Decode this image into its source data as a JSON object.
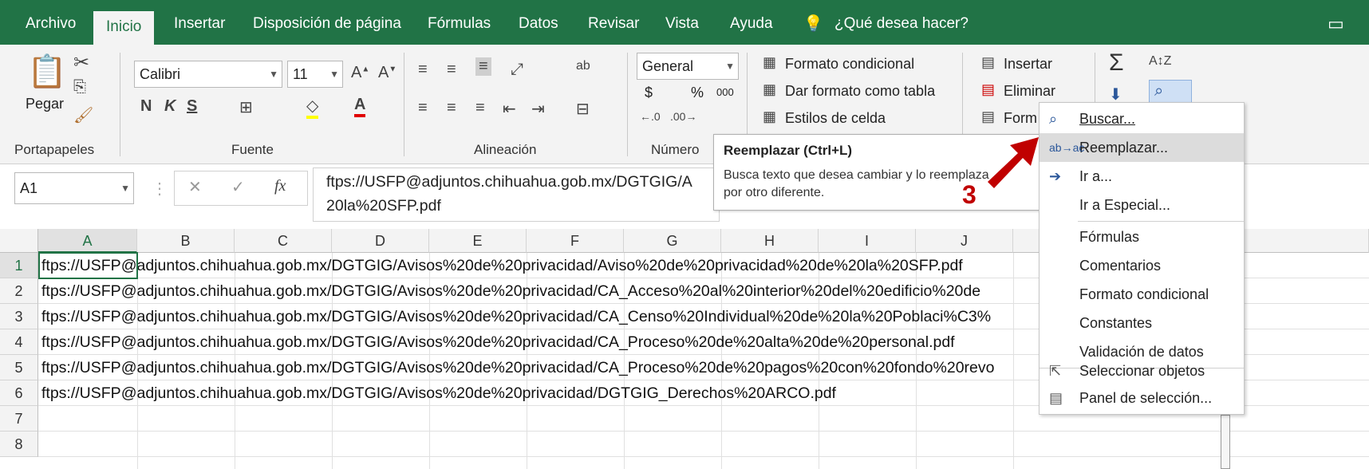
{
  "tabs": [
    "Archivo",
    "Inicio",
    "Insertar",
    "Disposición de página",
    "Fórmulas",
    "Datos",
    "Revisar",
    "Vista",
    "Ayuda",
    "¿Qué desea hacer?"
  ],
  "ribbon": {
    "clipboard": {
      "paste": "Pegar",
      "group": "Portapapeles"
    },
    "font": {
      "name": "Calibri",
      "size": "11",
      "group": "Fuente"
    },
    "alignment": {
      "group": "Alineación"
    },
    "number": {
      "format": "General",
      "currency": "$",
      "percent": "%",
      "thousands": "000",
      "group": "Número"
    },
    "styles": {
      "conditional": "Formato condicional",
      "as_table": "Dar formato como tabla",
      "cell_styles": "Estilos de celda"
    },
    "cells": {
      "insert": "Insertar",
      "delete": "Eliminar",
      "format": "Form"
    }
  },
  "formula_bar": {
    "namebox": "A1",
    "content_line1": "ftps://USFP@adjuntos.chihuahua.gob.mx/DGTGIG/A",
    "content_line2": "20la%20SFP.pdf"
  },
  "tooltip": {
    "title": "Reemplazar (Ctrl+L)",
    "body_line1": "Busca texto que desea cambiar y lo reemplaza",
    "body_line2": "por otro diferente."
  },
  "annotation": {
    "number": "3",
    "arrow_color": "#c00000"
  },
  "menu": [
    "Buscar...",
    "Reemplazar...",
    "Ir a...",
    "Ir a Especial...",
    "Fórmulas",
    "Comentarios",
    "Formato condicional",
    "Constantes",
    "Validación de datos",
    "Seleccionar objetos",
    "Panel de selección..."
  ],
  "columns": [
    "A",
    "B",
    "C",
    "D",
    "E",
    "F",
    "G",
    "H",
    "I",
    "J"
  ],
  "rows": [
    "1",
    "2",
    "3",
    "4",
    "5",
    "6",
    "7",
    "8"
  ],
  "cells": [
    "ftps://USFP@adjuntos.chihuahua.gob.mx/DGTGIG/Avisos%20de%20privacidad/Aviso%20de%20privacidad%20de%20la%20SFP.pdf",
    "ftps://USFP@adjuntos.chihuahua.gob.mx/DGTGIG/Avisos%20de%20privacidad/CA_Acceso%20al%20interior%20del%20edificio%20de",
    "ftps://USFP@adjuntos.chihuahua.gob.mx/DGTGIG/Avisos%20de%20privacidad/CA_Censo%20Individual%20de%20la%20Poblaci%C3%",
    "ftps://USFP@adjuntos.chihuahua.gob.mx/DGTGIG/Avisos%20de%20privacidad/CA_Proceso%20de%20alta%20de%20personal.pdf",
    "ftps://USFP@adjuntos.chihuahua.gob.mx/DGTGIG/Avisos%20de%20privacidad/CA_Proceso%20de%20pagos%20con%20fondo%20revo",
    "ftps://USFP@adjuntos.chihuahua.gob.mx/DGTGIG/Avisos%20de%20privacidad/DGTGIG_Derechos%20ARCO.pdf"
  ],
  "colors": {
    "brand": "#217346",
    "accent": "#2b579a"
  }
}
